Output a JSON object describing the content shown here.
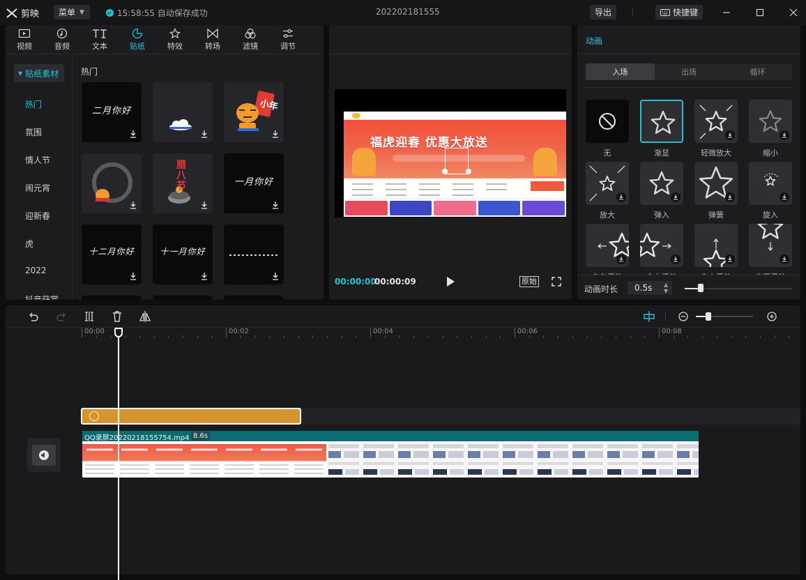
{
  "app": {
    "name": "剪映",
    "menu_label": "菜单",
    "save_status": "15:58:55 自动保存成功",
    "project_title": "202202181555",
    "export_label": "导出",
    "shortcut_label": "快捷键"
  },
  "toolbar": {
    "tabs": [
      {
        "label": "视频",
        "icon": "video-icon"
      },
      {
        "label": "音频",
        "icon": "audio-icon"
      },
      {
        "label": "文本",
        "icon": "text-icon"
      },
      {
        "label": "贴纸",
        "icon": "sticker-icon",
        "active": true
      },
      {
        "label": "特效",
        "icon": "effects-icon"
      },
      {
        "label": "转场",
        "icon": "transition-icon"
      },
      {
        "label": "滤镜",
        "icon": "filter-icon"
      },
      {
        "label": "调节",
        "icon": "adjust-icon"
      }
    ]
  },
  "stickers": {
    "category": "贴纸素材",
    "sidebar": [
      "热门",
      "氛围",
      "情人节",
      "闹元宵",
      "迎新春",
      "虎",
      "2022",
      "抖音获赏"
    ],
    "active_item": "热门",
    "section_title": "热门",
    "items": [
      {
        "text": "二月你好",
        "kind": "handwriting"
      },
      {
        "text": "",
        "kind": "cloud"
      },
      {
        "text": "小年",
        "kind": "tiger"
      },
      {
        "text": "",
        "kind": "ring"
      },
      {
        "text": "腊八节",
        "kind": "laba"
      },
      {
        "text": "一月你好",
        "kind": "handwriting"
      },
      {
        "text": "十二月你好",
        "kind": "handwriting"
      },
      {
        "text": "十一月你好",
        "kind": "handwriting"
      },
      {
        "text": "",
        "kind": "dotline"
      }
    ]
  },
  "preview": {
    "headline": "福虎迎春 优惠大放送",
    "current_time": "00:00:00",
    "total_time": "00:00:09",
    "ratio_label": "原始"
  },
  "inspector": {
    "title": "动画",
    "tabs": [
      "入场",
      "出场",
      "循环"
    ],
    "active_tab": "入场",
    "animations": [
      {
        "label": "无",
        "icon": "none-icon"
      },
      {
        "label": "渐显",
        "icon": "star-icon",
        "selected": true
      },
      {
        "label": "轻微放大",
        "icon": "star-expand-icon"
      },
      {
        "label": "缩小",
        "icon": "star-shrink-icon"
      },
      {
        "label": "放大",
        "icon": "star-zoom-icon"
      },
      {
        "label": "弹入",
        "icon": "star-icon"
      },
      {
        "label": "弹簧",
        "icon": "star-large-icon"
      },
      {
        "label": "旋入",
        "icon": "star-rotate-icon"
      },
      {
        "label": "向左滑动",
        "icon": "slide-left-icon"
      },
      {
        "label": "向右滑动",
        "icon": "slide-right-icon"
      },
      {
        "label": "向上滑动",
        "icon": "slide-up-icon"
      },
      {
        "label": "向下滑动",
        "icon": "slide-down-icon"
      }
    ],
    "duration_label": "动画时长",
    "duration_value": "0.5s",
    "duration_fraction": 0.15
  },
  "timeline": {
    "ruler": [
      "00:00",
      "00:02",
      "00:04",
      "00:06",
      "00:08"
    ],
    "zoom_fraction": 0.22,
    "video_clip": {
      "name": "QQ录屏20220218155754.mp4",
      "duration": "8.6s"
    }
  },
  "colors": {
    "accent": "#1fc5d6",
    "sticker_clip": "#d8942c",
    "video_clip_header": "#0a6c72"
  }
}
